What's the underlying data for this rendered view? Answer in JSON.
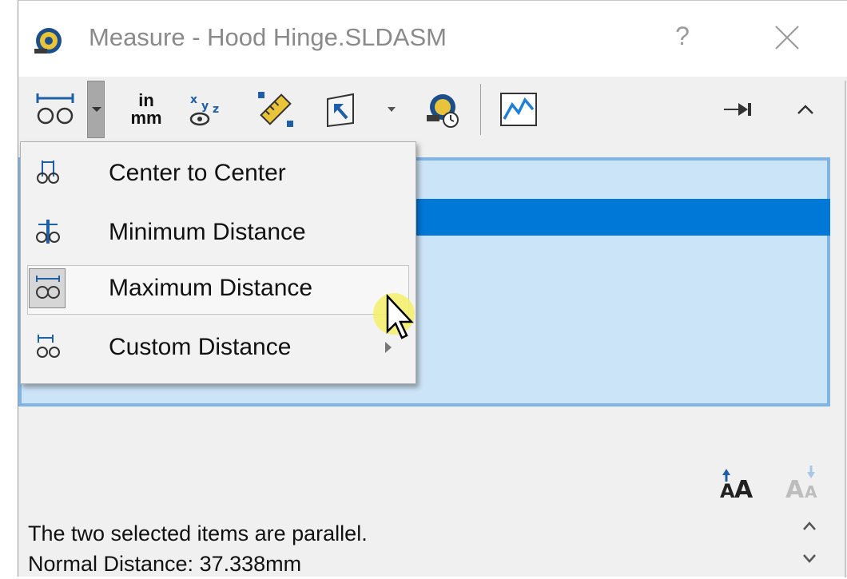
{
  "window": {
    "title": "Measure - Hood Hinge.SLDASM",
    "help_label": "?",
    "icon": "tape-measure-icon",
    "close_icon": "close-icon"
  },
  "toolbar": {
    "units_top": "in",
    "units_bottom": "mm",
    "buttons": [
      {
        "name": "arc-circle-measurements-icon"
      },
      {
        "name": "units-precision-icon"
      },
      {
        "name": "show-xyz-measurements-icon"
      },
      {
        "name": "point-to-point-icon"
      },
      {
        "name": "projection-icon"
      },
      {
        "name": "measure-history-icon"
      },
      {
        "name": "create-sensor-icon"
      },
      {
        "name": "pin-icon"
      },
      {
        "name": "collapse-icon"
      }
    ]
  },
  "dropdown_menu": {
    "items": [
      {
        "label": "Center to Center",
        "icon": "center-to-center-icon"
      },
      {
        "label": "Minimum Distance",
        "icon": "minimum-distance-icon"
      },
      {
        "label": "Maximum Distance",
        "icon": "maximum-distance-icon",
        "hovered": true
      },
      {
        "label": "Custom Distance",
        "icon": "custom-distance-icon",
        "has_submenu": true
      }
    ]
  },
  "results": {
    "line1": "The two selected items are parallel.",
    "line2": "Normal Distance: 37.338mm"
  },
  "colors": {
    "selection_blue": "#0078d7",
    "panel_bg": "#cce4f7",
    "panel_border": "#7fb5e6",
    "window_bg": "#f0f0f0"
  }
}
